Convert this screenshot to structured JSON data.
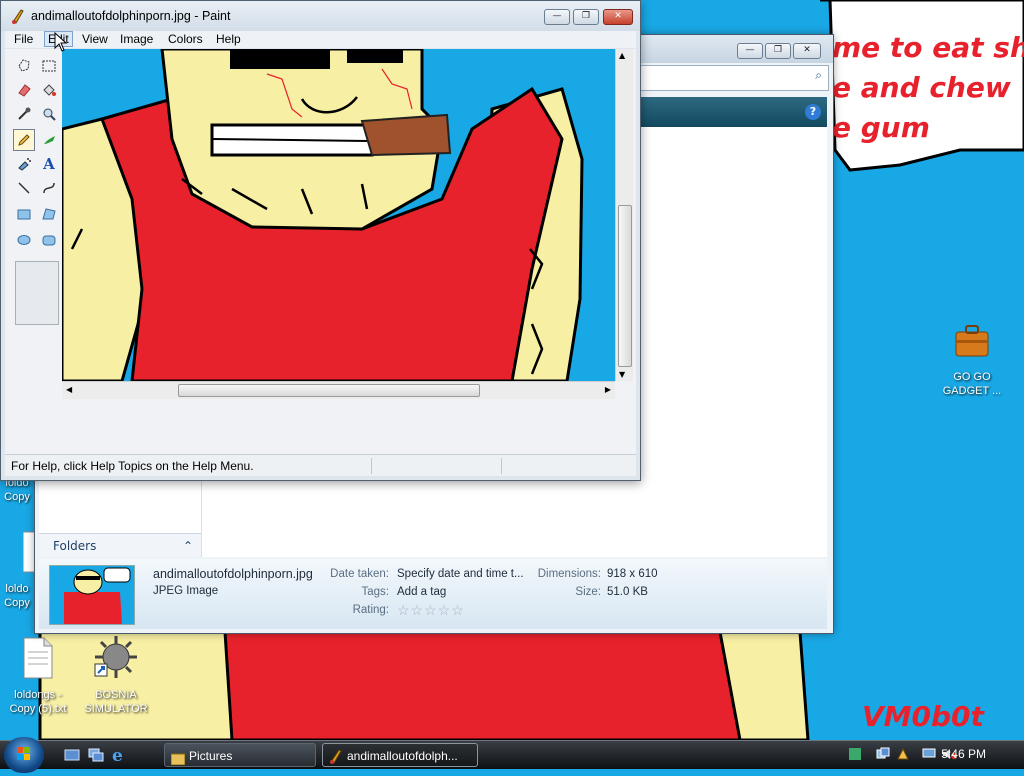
{
  "desktop": {
    "speech_bubble": "me to eat shit\ne and chew\ne gum",
    "signature": "VM0b0t",
    "icons": [
      {
        "label": "GO GO\nGADGET ..."
      },
      {
        "label": "loldongs -\nCopy (5).txt"
      },
      {
        "label": "BOSNIA\nSIMULATOR"
      },
      {
        "label": "loldo\nCopy"
      },
      {
        "label": "loldo\nCopy"
      }
    ]
  },
  "paint": {
    "title": "andimalloutofdolphinporn.jpg - Paint",
    "menu": [
      "File",
      "Edit",
      "View",
      "Image",
      "Colors",
      "Help"
    ],
    "active_menu": "Edit",
    "status": "For Help, click Help Topics on the Help Menu.",
    "colors": {
      "foreground": "#e8222c",
      "background": "#ffffff",
      "palette_row1": [
        "#000000",
        "#404040",
        "#808080",
        "#800000",
        "#e8222c",
        "#f46a1a",
        "#f7a91b",
        "#f6e01b",
        "#9cd52a",
        "#22b24c",
        "#1aa7e6",
        "#3562c8",
        "#3a3596",
        "#7d3da4"
      ],
      "palette_row2": [
        "#ffffff",
        "#c8c8c8",
        "#b4b4b4",
        "#b97a57",
        "#f5a3bf",
        "#f9c98f",
        "#fde28b",
        "#f3f3a0",
        "#c7e07a",
        "#9bd1a1",
        "#99d9ea",
        "#7c9ad6",
        "#a1a8d6",
        "#c8bfe7"
      ]
    },
    "tools": [
      "free-select-icon",
      "rect-select-icon",
      "eraser-icon",
      "fill-icon",
      "picker-icon",
      "magnifier-icon",
      "pencil-icon",
      "brush-icon",
      "airbrush-icon",
      "text-icon",
      "line-icon",
      "curve-icon",
      "rectangle-icon",
      "polygon-icon",
      "ellipse-icon",
      "rounded-rect-icon"
    ]
  },
  "explorer": {
    "folders_label": "Folders",
    "file_name": "andimalloutofdolphinporn.jpg",
    "file_type": "JPEG Image",
    "date_taken_label": "Date taken:",
    "date_taken_value": "Specify date and time t...",
    "tags_label": "Tags:",
    "tags_value": "Add a tag",
    "rating_label": "Rating:",
    "rating_value": 0,
    "dimensions_label": "Dimensions:",
    "dimensions_value": "918 x 610",
    "size_label": "Size:",
    "size_value": "51.0 KB"
  },
  "taskbar": {
    "buttons": [
      "Pictures",
      "andimalloutofdolph..."
    ],
    "clock": "5:46 PM"
  }
}
